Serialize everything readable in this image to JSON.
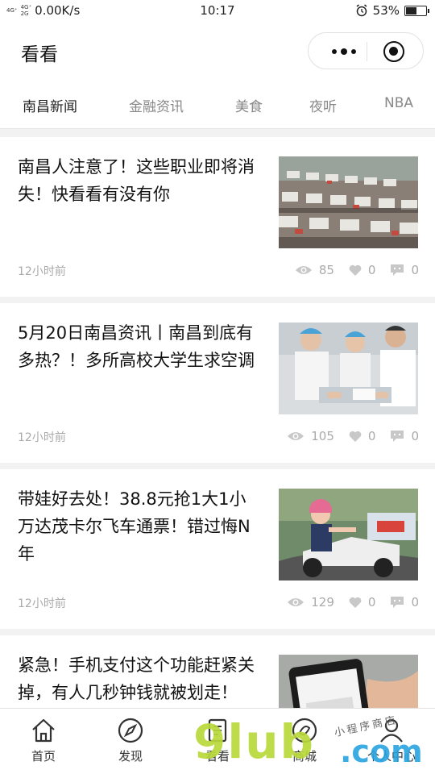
{
  "status_bar": {
    "signal_1": "4G⁺",
    "signal_2": "4G⁺",
    "signal_3": "2G",
    "network_speed": "0.00K/s",
    "time": "10:17",
    "battery": "53%",
    "battery_level": 0.53
  },
  "nav": {
    "title": "看看"
  },
  "tabs": [
    {
      "label": "南昌新闻",
      "active": true
    },
    {
      "label": "金融资讯",
      "active": false
    },
    {
      "label": "美食",
      "active": false
    },
    {
      "label": "夜听",
      "active": false
    },
    {
      "label": "NBA",
      "active": false
    }
  ],
  "articles": [
    {
      "title": "南昌人注意了！这些职业即将消失！快看看有没有你",
      "time": "12小时前",
      "views": "85",
      "likes": "0",
      "comments": "0",
      "image": "job-fair-crowd"
    },
    {
      "title": "5月20日南昌资讯丨南昌到底有多热？！多所高校大学生求空调",
      "time": "12小时前",
      "views": "105",
      "likes": "0",
      "comments": "0",
      "image": "students-at-table"
    },
    {
      "title": "带娃好去处！38.8元抢1大1小万达茂卡尔飞车通票！错过悔N年",
      "time": "12小时前",
      "views": "129",
      "likes": "0",
      "comments": "0",
      "image": "child-in-go-kart"
    },
    {
      "title": "紧急！手机支付这个功能赶紧关掉，有人几秒钟钱就被划走！",
      "time": "",
      "views": "",
      "likes": "",
      "comments": "",
      "image": "hand-holding-phone"
    }
  ],
  "tabbar": [
    {
      "label": "首页",
      "icon": "home-icon"
    },
    {
      "label": "发现",
      "icon": "compass-icon"
    },
    {
      "label": "看看",
      "icon": "document-icon"
    },
    {
      "label": "商城",
      "icon": "store-icon"
    },
    {
      "label": "个人中心",
      "icon": "user-icon"
    }
  ],
  "watermark": {
    "logo": "9lub",
    "domain": ".com",
    "tagline": "小程序商店"
  },
  "colors": {
    "icon_gray": "#c8c8c8",
    "meta_text": "#aaaaaa",
    "background": "#f2f2f2"
  }
}
